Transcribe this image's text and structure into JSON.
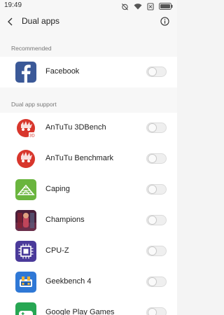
{
  "status_bar": {
    "time": "19:49"
  },
  "header": {
    "title": "Dual apps"
  },
  "sections": [
    {
      "title": "Recommended"
    },
    {
      "title": "Dual app support"
    }
  ],
  "apps": [
    {
      "name": "Facebook",
      "icon": "facebook-icon",
      "enabled": false
    },
    {
      "name": "AnTuTu 3DBench",
      "icon": "antutu-3dbench-icon",
      "enabled": false
    },
    {
      "name": "AnTuTu Benchmark",
      "icon": "antutu-benchmark-icon",
      "enabled": false
    },
    {
      "name": "Caping",
      "icon": "caping-icon",
      "enabled": false
    },
    {
      "name": "Champions",
      "icon": "champions-icon",
      "enabled": false
    },
    {
      "name": "CPU-Z",
      "icon": "cpu-z-icon",
      "enabled": false
    },
    {
      "name": "Geekbench 4",
      "icon": "geekbench-icon",
      "enabled": false
    },
    {
      "name": "Google Play Games",
      "icon": "google-play-games-icon",
      "enabled": false
    }
  ],
  "colors": {
    "facebook": "#3b5998",
    "antutu": "#d8362c",
    "caping": "#6ab53e",
    "cpuz": "#4a3a9a",
    "geekbench": "#2f78d6",
    "playgames": "#27a653"
  }
}
